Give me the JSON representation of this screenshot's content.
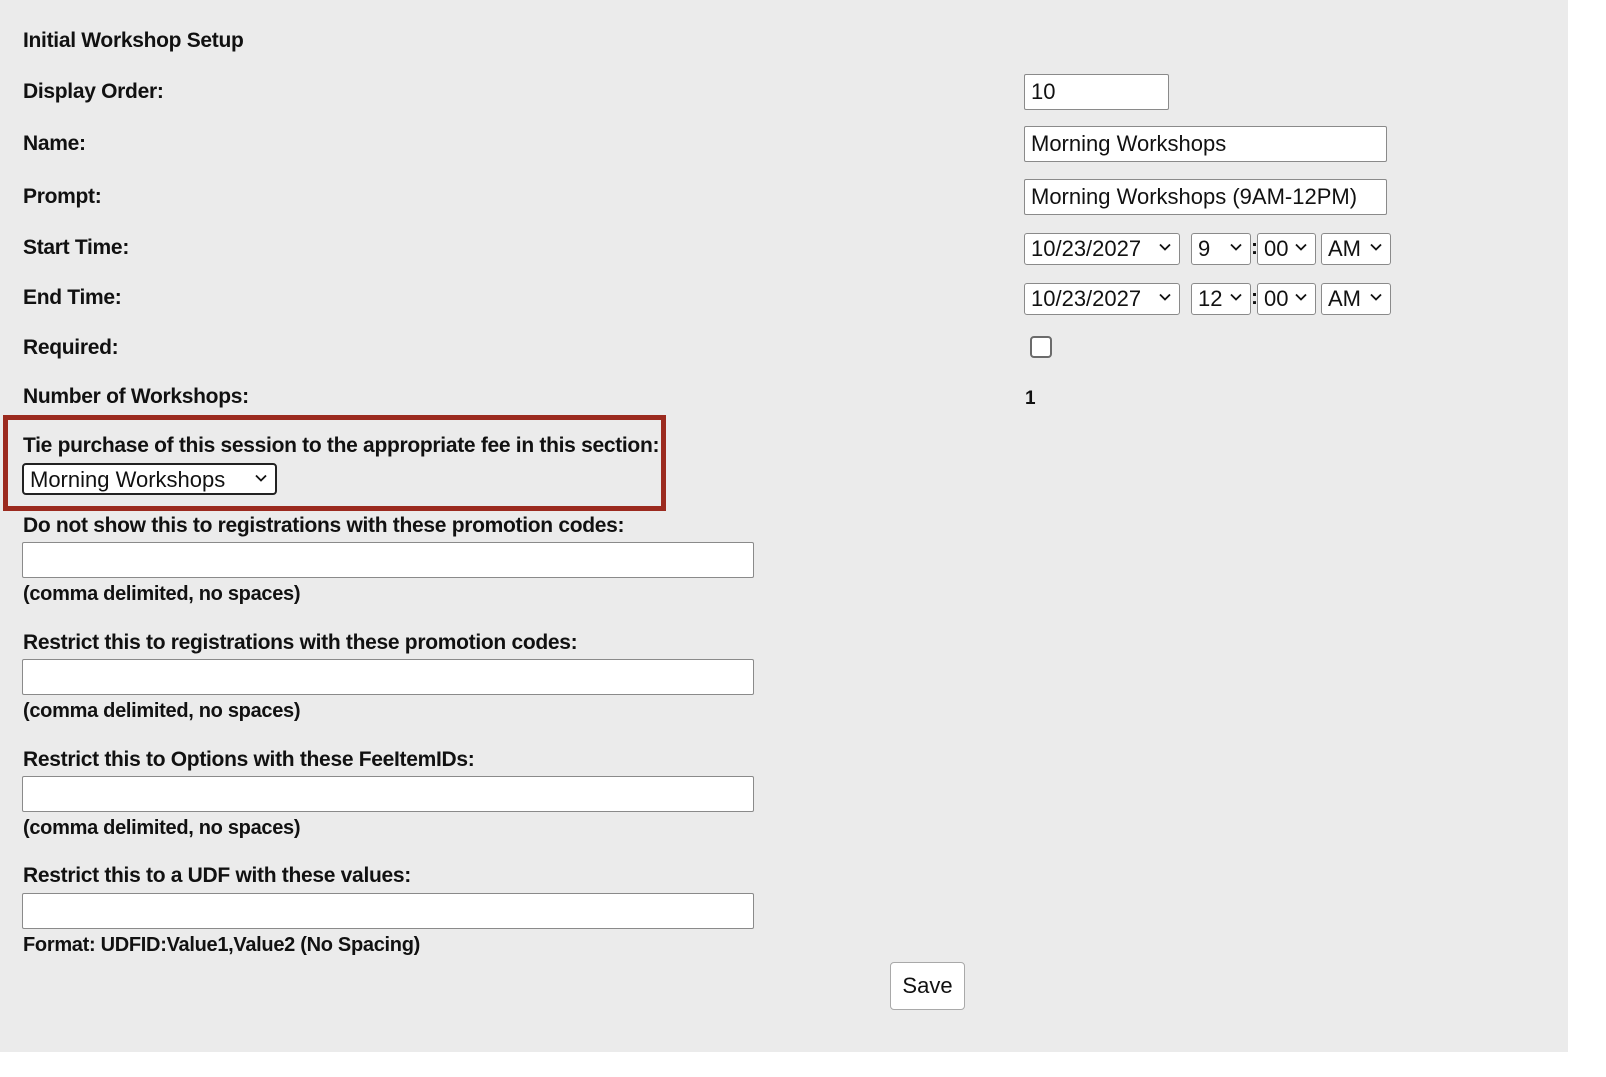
{
  "form": {
    "section_title": "Initial Workshop Setup",
    "display_order": {
      "label": "Display Order:",
      "value": "10"
    },
    "name": {
      "label": "Name:",
      "value": "Morning Workshops"
    },
    "prompt": {
      "label": "Prompt:",
      "value": "Morning Workshops (9AM-12PM)"
    },
    "start_time": {
      "label": "Start Time:",
      "date": "10/23/2027",
      "hour": "9",
      "minute": "00",
      "ampm": "AM",
      "separator": ":"
    },
    "end_time": {
      "label": "End Time:",
      "date": "10/23/2027",
      "hour": "12",
      "minute": "00",
      "ampm": "AM",
      "separator": ":"
    },
    "required": {
      "label": "Required:",
      "checked": false
    },
    "number_of_workshops": {
      "label": "Number of Workshops:",
      "value": "1"
    },
    "tie_purchase": {
      "label": "Tie purchase of this session to the appropriate fee in this section:",
      "selected": "Morning Workshops"
    },
    "exclude_promo": {
      "label": "Do not show this to registrations with these promotion codes:",
      "value": "",
      "hint": "(comma delimited, no spaces)"
    },
    "restrict_promo": {
      "label": "Restrict this to registrations with these promotion codes:",
      "value": "",
      "hint": "(comma delimited, no spaces)"
    },
    "restrict_feeitems": {
      "label": "Restrict this to Options with these FeeItemIDs:",
      "value": "",
      "hint": "(comma delimited, no spaces)"
    },
    "restrict_udf": {
      "label": "Restrict this to a UDF with these values:",
      "value": "",
      "hint": "Format: UDFID:Value1,Value2 (No Spacing)"
    },
    "save_label": "Save"
  },
  "colors": {
    "background": "#ebebeb",
    "highlight_border": "#9b2a1f"
  },
  "icons": {
    "dropdown": "chevron-down-icon"
  }
}
